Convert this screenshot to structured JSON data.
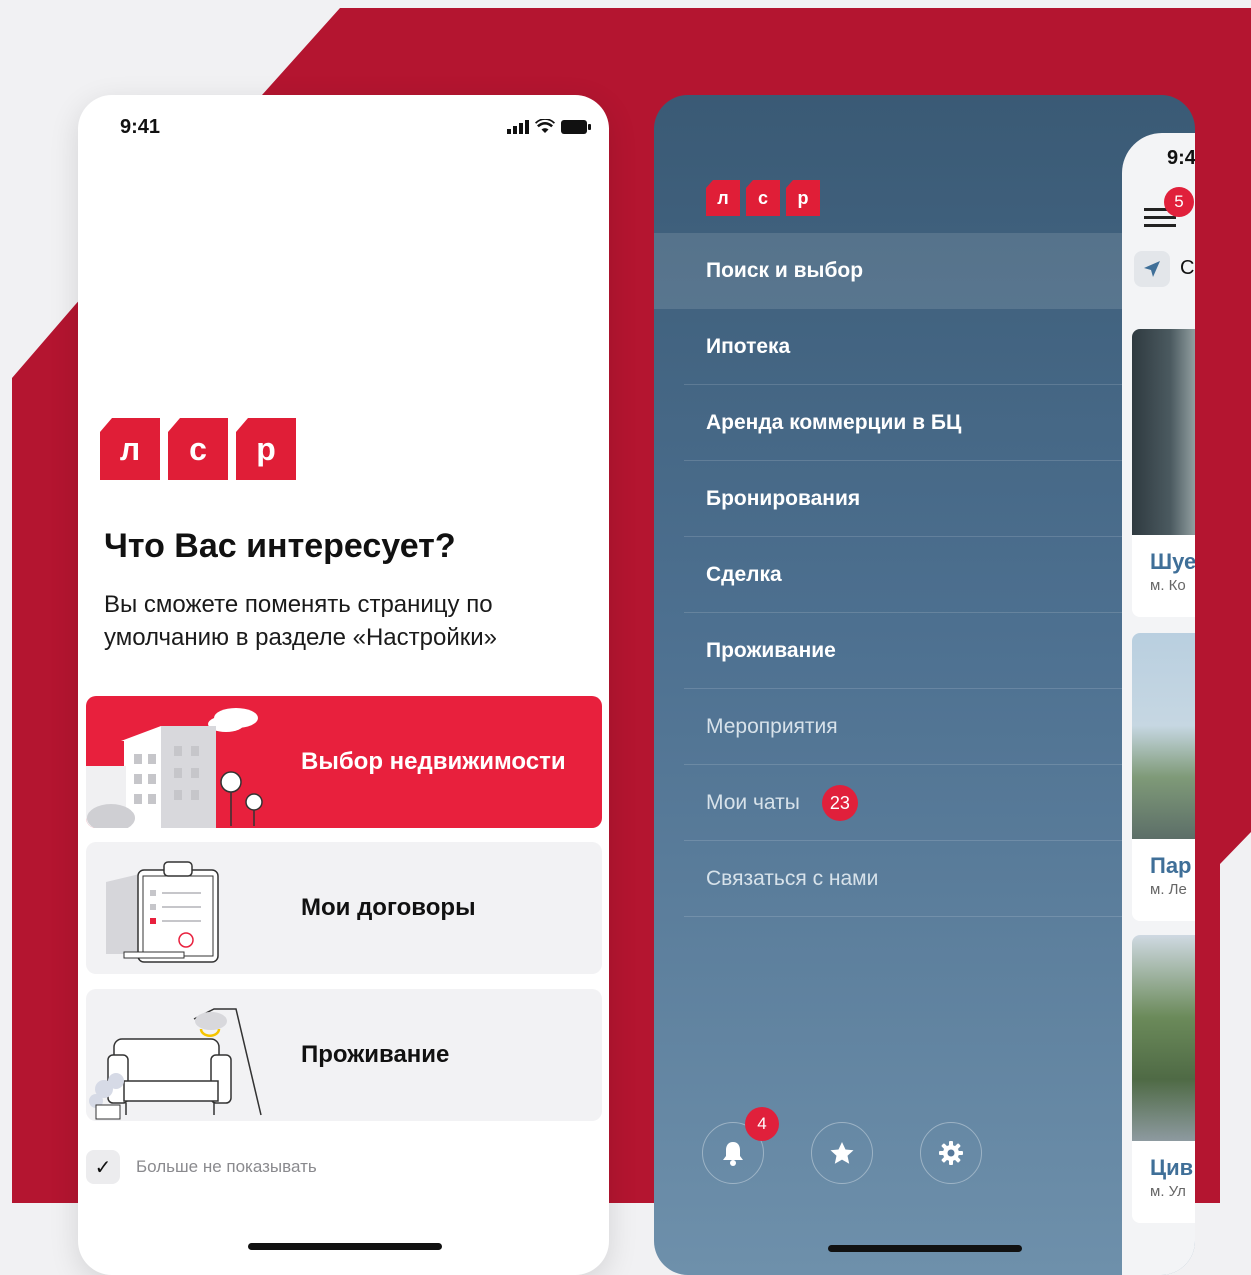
{
  "colors": {
    "brand_red": "#e8203d",
    "backdrop_red": "#b41530",
    "menu_blue": "#46688a"
  },
  "logo": {
    "letters": [
      "л",
      "с",
      "р"
    ]
  },
  "onboarding": {
    "status_time": "9:41",
    "title": "Что Вас интересует?",
    "subtitle": "Вы сможете поменять страницу по умолчанию в разделе «Настройки»",
    "choices": [
      {
        "label": "Выбор недвижимости",
        "icon": "buildings-illustration",
        "active": true
      },
      {
        "label": "Мои договоры",
        "icon": "clipboard-illustration",
        "active": false
      },
      {
        "label": "Проживание",
        "icon": "sofa-lamp-illustration",
        "active": false
      }
    ],
    "dont_show_label": "Больше не показывать",
    "dont_show_checked": true
  },
  "menu": {
    "items": [
      {
        "label": "Поиск и выбор"
      },
      {
        "label": "Ипотека"
      },
      {
        "label": "Аренда коммерции в БЦ"
      },
      {
        "label": "Бронирования"
      },
      {
        "label": "Сделка"
      },
      {
        "label": "Проживание"
      },
      {
        "label": "Мероприятия"
      },
      {
        "label": "Мои чаты",
        "badge": "23"
      },
      {
        "label": "Связаться с нами"
      }
    ],
    "notifications_badge": "4",
    "bottom_icons": [
      "bell-icon",
      "star-icon",
      "gear-icon"
    ]
  },
  "peek": {
    "status_time": "9:4",
    "menu_badge": "5",
    "location_text": "С",
    "cards": [
      {
        "name": "Шуе",
        "metro": "м. Ко"
      },
      {
        "name": "Пар",
        "metro": "м. Ле"
      },
      {
        "name": "Цив",
        "metro": "м. Ул"
      }
    ]
  }
}
